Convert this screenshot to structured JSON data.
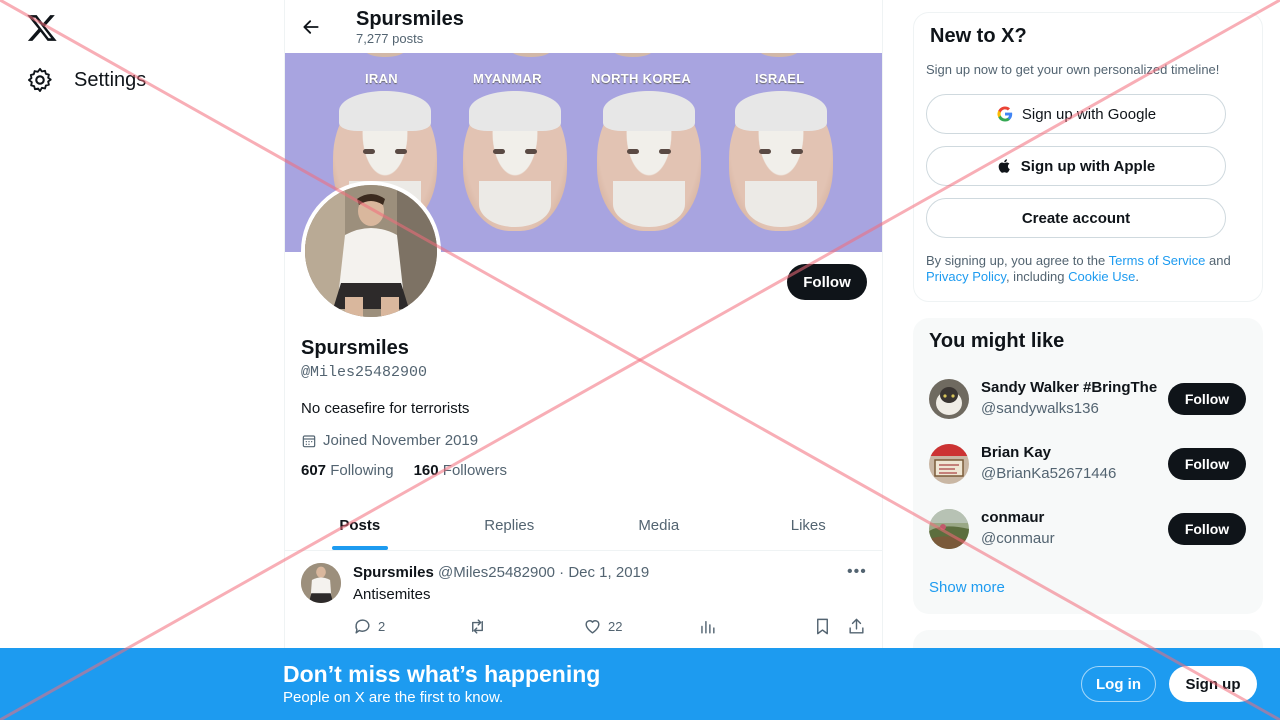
{
  "nav": {
    "settings_label": "Settings"
  },
  "header": {
    "name": "Spursmiles",
    "post_count": "7,277 posts"
  },
  "banner": {
    "labels": [
      "IRAN",
      "MYANMAR",
      "NORTH KOREA",
      "ISRAEL"
    ]
  },
  "profile": {
    "name": "Spursmiles",
    "handle": "@Miles25482900",
    "bio": "No ceasefire for terrorists",
    "joined": "Joined November 2019",
    "following_count": "607",
    "following_label": "Following",
    "followers_count": "160",
    "followers_label": "Followers",
    "follow_label": "Follow"
  },
  "tabs": [
    "Posts",
    "Replies",
    "Media",
    "Likes"
  ],
  "post": {
    "name": "Spursmiles",
    "meta": "@Miles25482900 · Dec 1, 2019",
    "text": "Antisemites",
    "replies": "2",
    "likes": "22"
  },
  "signup_card": {
    "title": "New to X?",
    "subtitle": "Sign up now to get your own personalized timeline!",
    "google": "Sign up with Google",
    "apple": "Sign up with Apple",
    "create": "Create account",
    "legal_prefix": "By signing up, you agree to the ",
    "terms": "Terms of Service",
    "and": " and ",
    "privacy": "Privacy Policy",
    "including": ", including ",
    "cookie": "Cookie Use",
    "period": "."
  },
  "suggestions": {
    "title": "You might like",
    "follow_label": "Follow",
    "show_more": "Show more",
    "items": [
      {
        "name": "Sandy Walker #BringThe",
        "handle": "@sandywalks136"
      },
      {
        "name": "Brian Kay",
        "handle": "@BrianKa52671446"
      },
      {
        "name": "conmaur",
        "handle": "@conmaur"
      }
    ]
  },
  "bottom_bar": {
    "title": "Don’t miss what’s happening",
    "subtitle": "People on X are the first to know.",
    "login": "Log in",
    "signup": "Sign up"
  },
  "colors": {
    "accent": "#1d9bf0",
    "text": "#0f1419",
    "muted": "#536471",
    "banner": "#a8a4e0",
    "overlay": "#f6a5ae"
  }
}
